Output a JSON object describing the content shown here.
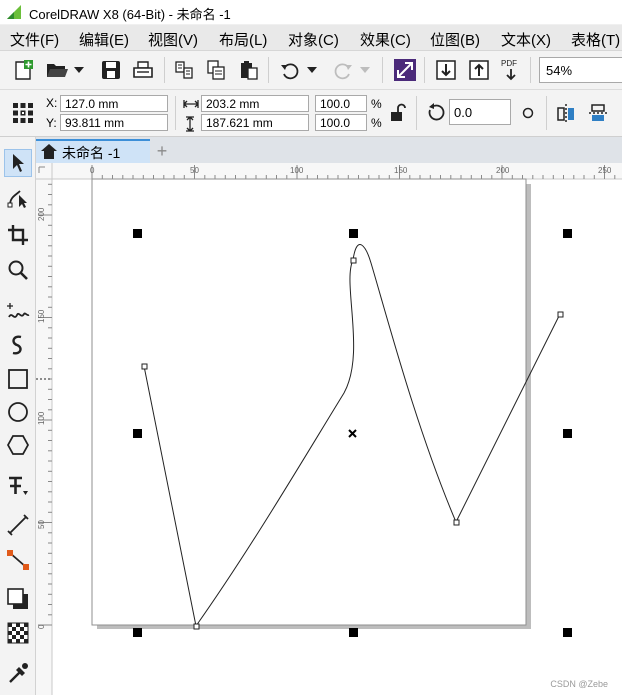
{
  "window": {
    "title": "CorelDRAW X8 (64-Bit) - 未命名 -1"
  },
  "menu": [
    "文件(F)",
    "编辑(E)",
    "视图(V)",
    "布局(L)",
    "对象(C)",
    "效果(C)",
    "位图(B)",
    "文本(X)",
    "表格(T)"
  ],
  "toolbar": {
    "zoom": "54%",
    "pdf_label": "PDF"
  },
  "properties": {
    "x_label": "X:",
    "x_value": "127.0 mm",
    "y_label": "Y:",
    "y_value": "93.811 mm",
    "width_value": "203.2 mm",
    "height_value": "187.621 mm",
    "scale_w": "100.0",
    "scale_h": "100.0",
    "percent": "%",
    "rotation": "0.0"
  },
  "document_tab": {
    "label": "未命名 -1",
    "add_label": "+"
  },
  "rulers": {
    "h_ticks": [
      "0",
      "50",
      "100",
      "150",
      "200",
      "250"
    ],
    "v_ticks": [
      "200",
      "150",
      "100",
      "50",
      "0"
    ]
  },
  "watermark": "CSDN @Zebe"
}
